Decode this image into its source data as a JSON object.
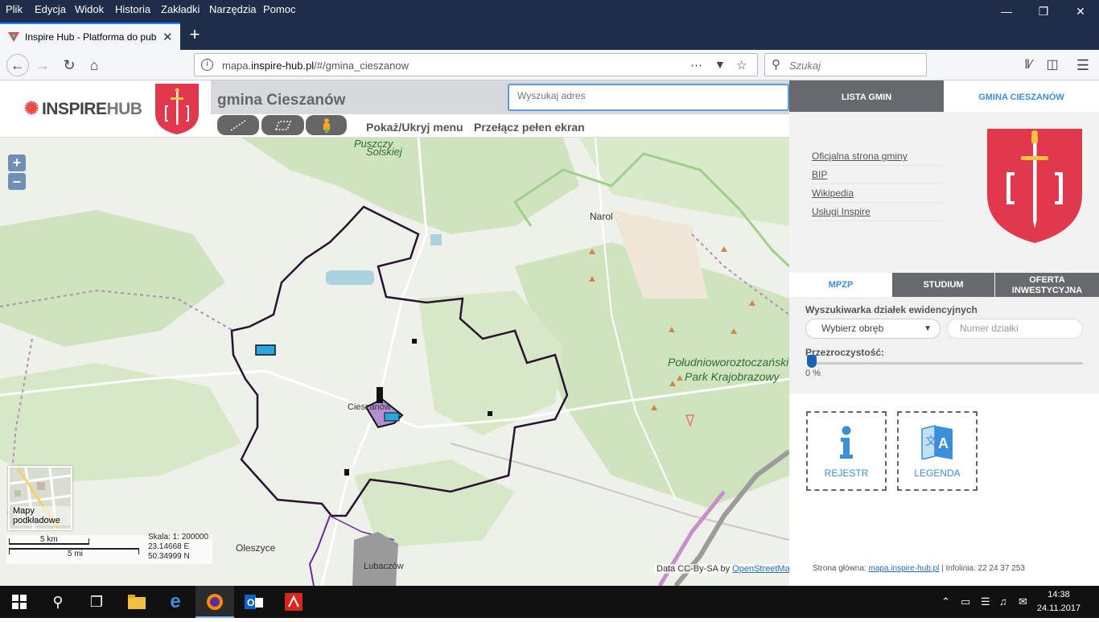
{
  "browser": {
    "menu": [
      "Plik",
      "Edycja",
      "Widok",
      "Historia",
      "Zakładki",
      "Narzędzia",
      "Pomoc"
    ],
    "tab_title": "Inspire Hub - Platforma do pub",
    "url_prefix": "mapa.",
    "url_host": "inspire-hub.pl",
    "url_path": "/#/gmina_cieszanow",
    "search_placeholder": "Szukaj"
  },
  "app": {
    "logo_main": "INSPIRE",
    "logo_hub": "HUB",
    "gmina_title": "gmina Cieszanów",
    "address_placeholder": "Wyszukaj adres",
    "toggle_menu": "Pokaż/Ukryj menu",
    "fullscreen": "Przełącz pełen ekran"
  },
  "map": {
    "labels": {
      "puszczy": "Puszczy",
      "solskiej": "Solskiej",
      "narol": "Narol",
      "park1": "Południoworoztoczański",
      "park2": "Park Krajobrazowy",
      "cieszanow": "Cieszanów",
      "oleszyce": "Oleszyce",
      "lubaczow": "Lubaczów"
    },
    "basemap_label": "Mapy podkładowe",
    "scale_km": "5 km",
    "scale_mi": "5 mi",
    "scale_text": "Skala: 1: 200000",
    "coord_e": "23.14668 E",
    "coord_n": "50.34999 N",
    "attribution_prefix": "Data CC-By-SA by",
    "attribution_link": "OpenStreetMap"
  },
  "panel": {
    "tab_lista": "LISTA GMIN",
    "tab_gmina": "GMINA CIESZANÓW",
    "links": [
      "Oficjalna strona gminy",
      "BIP",
      "Wikipedia",
      "Usługi Inspire"
    ],
    "tab_mpzp": "MPZP",
    "tab_studium": "STUDIUM",
    "tab_oferta": "OFERTA INWESTYCYJNA",
    "search_title": "Wyszukiwarka działek ewidencyjnych",
    "obreb_placeholder": "Wybierz obręb",
    "numer_placeholder": "Numer działki",
    "opacity_label": "Przezroczystość:",
    "opacity_value": "0 %",
    "opacity_fraction": 0,
    "btn_rejestr": "REJESTR",
    "btn_legenda": "LEGENDA",
    "footer_prefix": "Strona główna:",
    "footer_link": "mapa.inspire-hub.pl",
    "footer_suffix": "| Infolinia: 22 24 37 253"
  },
  "taskbar": {
    "time": "14:38",
    "date": "24.11.2017"
  },
  "colors": {
    "accent": "#3b8ed8",
    "panel_dark": "#666a6e",
    "crest_red": "#e2384d",
    "boundary": "#2a1330"
  }
}
